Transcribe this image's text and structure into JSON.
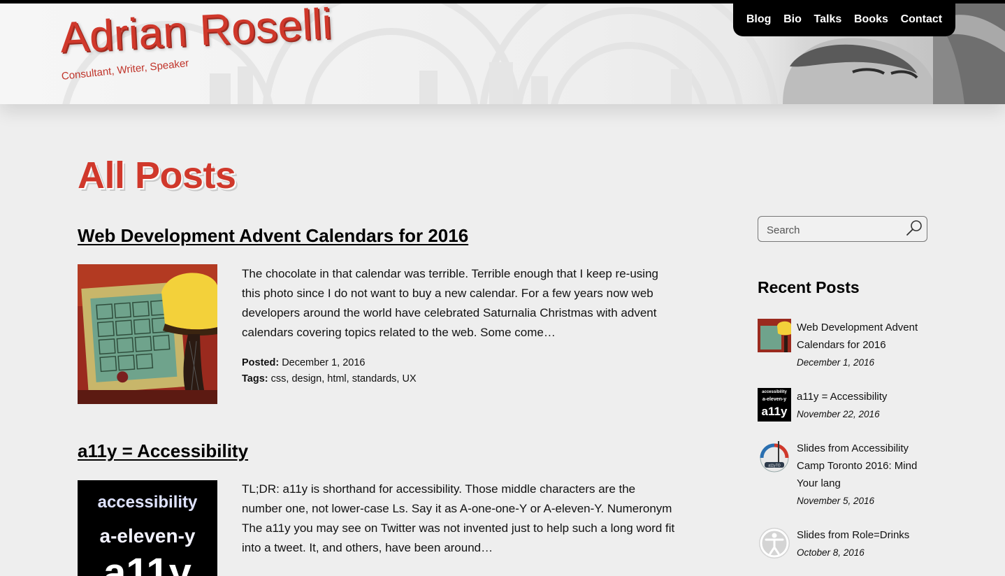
{
  "site": {
    "name": "Adrian Roselli",
    "tagline": "Consultant, Writer, Speaker"
  },
  "nav": {
    "items": [
      {
        "label": "Blog"
      },
      {
        "label": "Bio"
      },
      {
        "label": "Talks"
      },
      {
        "label": "Books"
      },
      {
        "label": "Contact"
      }
    ]
  },
  "main": {
    "title": "All Posts",
    "posts": [
      {
        "title": "Web Development Advent Calendars for 2016",
        "excerpt": "The chocolate in that calendar was terrible. Terrible enough that I keep re-using this photo since I do not want to buy a new calendar. For a few years now web developers around the world have celebrated Saturnalia Christmas with advent calendars covering topics related to the web. Some come…",
        "posted_label": "Posted:",
        "posted_date": "December 1, 2016",
        "tags_label": "Tags:",
        "tags": [
          "css",
          "design",
          "html",
          "standards",
          "UX"
        ],
        "thumb": "advent-calendar-photo"
      },
      {
        "title": "a11y = Accessibility",
        "excerpt": "TL;DR: a11y is shorthand for accessibility. Those middle characters are the number one, not lower-case Ls. Say it as A-one-one-Y or A-eleven-Y. Numeronym The a11y you may see on Twitter was not invented just to help such a long word fit into a tweet. It, and others, have been around…",
        "thumb_text": [
          "accessibility",
          "a-eleven-y",
          "a11y"
        ]
      }
    ]
  },
  "sidebar": {
    "search": {
      "placeholder": "Search"
    },
    "recent_title": "Recent Posts",
    "recent": [
      {
        "title": "Web Development Advent Calendars for 2016",
        "date": "December 1, 2016"
      },
      {
        "title": "a11y = Accessibility",
        "date": "November 22, 2016",
        "thumb_text": [
          "accessibility",
          "a-eleven-y",
          "a11y"
        ]
      },
      {
        "title": "Slides from Accessibility Camp Toronto 2016: Mind Your lang",
        "date": "November 5, 2016",
        "thumb_text": "a11yTO"
      },
      {
        "title": "Slides from Role=Drinks",
        "date": "October 8, 2016"
      }
    ]
  },
  "colors": {
    "brand_red": "#d0382b",
    "nav_bg": "#000000",
    "page_bg": "#eeeeee"
  }
}
